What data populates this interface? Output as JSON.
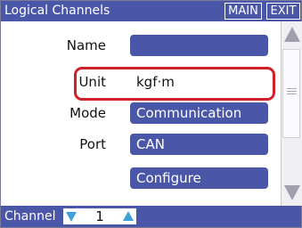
{
  "window": {
    "title": "Logical Channels",
    "main_button": "MAIN",
    "exit_button": "EXIT"
  },
  "form": {
    "name": {
      "label": "Name",
      "value": ""
    },
    "unit": {
      "label": "Unit",
      "value": "kgf·m"
    },
    "mode": {
      "label": "Mode",
      "value": "Communication"
    },
    "port": {
      "label": "Port",
      "value": "CAN"
    },
    "configure": {
      "label": "Configure"
    }
  },
  "footer": {
    "channel_label": "Channel",
    "channel_value": "1"
  },
  "icons": {
    "scroll_up": "triangle-up-icon",
    "scroll_down": "triangle-down-icon",
    "channel_prev": "triangle-down-icon",
    "channel_next": "triangle-up-icon"
  },
  "colors": {
    "accent": "#4a56a8",
    "highlight": "#d0202a",
    "spinner_arrow": "#3fa0d8"
  }
}
